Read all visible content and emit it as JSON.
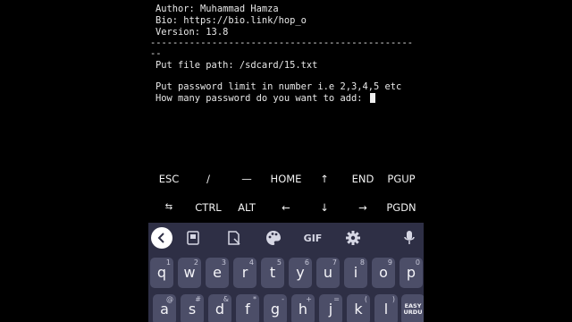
{
  "terminal": {
    "lines": [
      "Author: Muhammad Hamza",
      "Bio: https://bio.link/hop_o",
      "Version: 13.8",
      "-----------------------------------------------",
      "--",
      "Put file path: /sdcard/15.txt",
      "",
      "Put password limit in number i.e 2,3,4,5 etc",
      "How many password do you want to add: "
    ]
  },
  "extra_keys": {
    "row1": [
      "ESC",
      "/",
      "—",
      "HOME",
      "↑",
      "END",
      "PGUP"
    ],
    "row2": [
      "⇆",
      "CTRL",
      "ALT",
      "←",
      "↓",
      "→",
      "PGDN"
    ]
  },
  "keyboard": {
    "toolbar": {
      "back": "<",
      "gif": "GIF"
    },
    "row1": [
      {
        "key": "q",
        "sup": "1"
      },
      {
        "key": "w",
        "sup": "2"
      },
      {
        "key": "e",
        "sup": "3"
      },
      {
        "key": "r",
        "sup": "4"
      },
      {
        "key": "t",
        "sup": "5"
      },
      {
        "key": "y",
        "sup": "6"
      },
      {
        "key": "u",
        "sup": "7"
      },
      {
        "key": "i",
        "sup": "8"
      },
      {
        "key": "o",
        "sup": "9"
      },
      {
        "key": "p",
        "sup": "0"
      }
    ],
    "row2": [
      {
        "key": "a",
        "sup": "@"
      },
      {
        "key": "s",
        "sup": "#"
      },
      {
        "key": "d",
        "sup": "&"
      },
      {
        "key": "f",
        "sup": "*"
      },
      {
        "key": "g",
        "sup": "-"
      },
      {
        "key": "h",
        "sup": "+"
      },
      {
        "key": "j",
        "sup": "="
      },
      {
        "key": "k",
        "sup": "("
      },
      {
        "key": "l",
        "sup": ")"
      },
      {
        "key": "EASY\nURDU",
        "sup": ""
      }
    ]
  }
}
